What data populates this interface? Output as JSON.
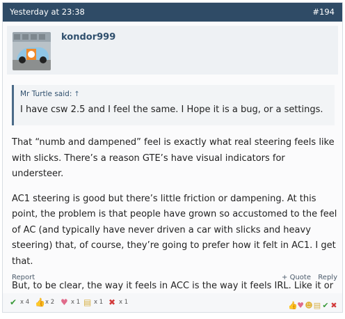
{
  "post": {
    "date": "Yesterday at 23:38",
    "number": "#194",
    "author": "kondor999"
  },
  "quote": {
    "attribution": "Mr Turtle said:",
    "arrow": "↑",
    "text": "I have csw 2.5 and I feel the same. I Hope it is a bug, or a settings."
  },
  "message": {
    "paragraphs": [
      "That “numb and dampened” feel is exactly what real steering feels like with slicks. There’s a reason GTE’s have visual indicators for understeer.",
      "AC1 steering is good but there’s little friction or dampening. At this point, the problem is that people have grown so accustomed to the feel of AC (and typically have never driven a car with slicks and heavy steering) that, of course, they’re going to prefer how it felt in AC1. I get that.",
      "But, to be clear, the way it feels in ACC is the way it feels IRL. Like it or not."
    ]
  },
  "actions": {
    "report": "Report",
    "quote": "+ Quote",
    "reply": "Reply"
  },
  "reactions": [
    {
      "icon": "checkmark-icon",
      "glyph": "✔",
      "color": "#3a9a3a",
      "count": "x 4"
    },
    {
      "icon": "thumbs-up-icon",
      "glyph": "👍",
      "color": "#d9a15b",
      "count": "x 2"
    },
    {
      "icon": "heart-icon",
      "glyph": "♥",
      "color": "#e06b8b",
      "count": "x 1"
    },
    {
      "icon": "notepad-icon",
      "glyph": "▤",
      "color": "#d8b24a",
      "count": "x 1"
    },
    {
      "icon": "cross-icon",
      "glyph": "✖",
      "color": "#d23a3a",
      "count": "x 1"
    }
  ],
  "rating_icons": [
    {
      "icon": "rate-thumbs-up-icon",
      "glyph": "👍",
      "color": "#d9a15b"
    },
    {
      "icon": "rate-heart-icon",
      "glyph": "♥",
      "color": "#e06b8b"
    },
    {
      "icon": "rate-smile-icon",
      "glyph": "☻",
      "color": "#e0b33a"
    },
    {
      "icon": "rate-notepad-icon",
      "glyph": "▤",
      "color": "#d8b24a"
    },
    {
      "icon": "rate-checkmark-icon",
      "glyph": "✔",
      "color": "#3a9a3a"
    },
    {
      "icon": "rate-cross-icon",
      "glyph": "✖",
      "color": "#d23a3a"
    }
  ]
}
